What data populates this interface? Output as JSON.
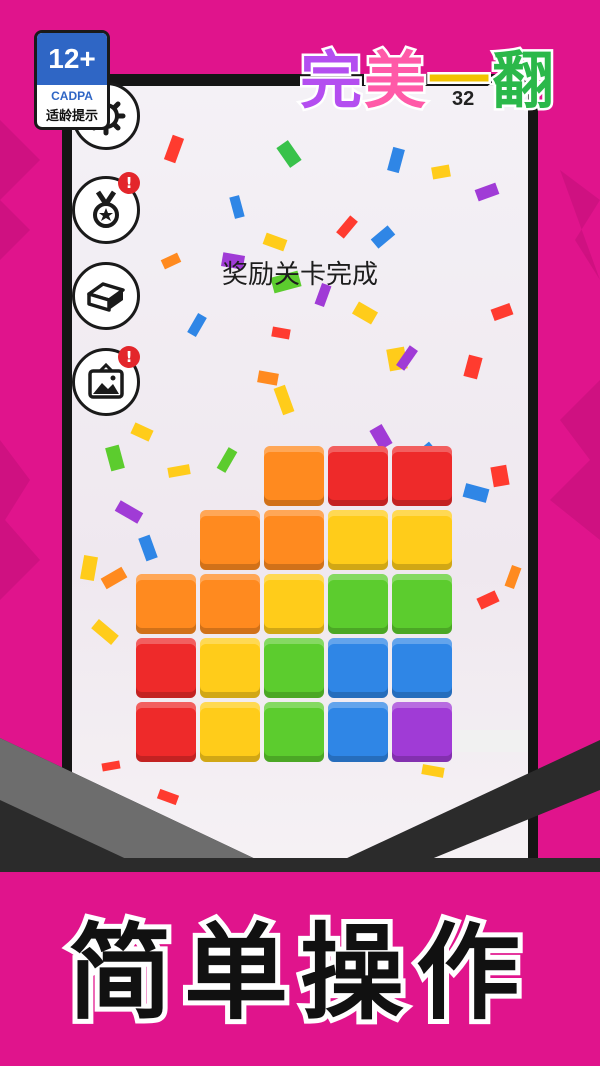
{
  "age_rating": {
    "label": "12+",
    "org": "CADPA",
    "notice": "适龄提示"
  },
  "game_title": {
    "chars": [
      "完",
      "美",
      "一",
      "翻"
    ],
    "colors": [
      "#b44ef0",
      "#ff5aa8",
      "#f2c200",
      "#2bb84a"
    ]
  },
  "level": {
    "number": "32"
  },
  "screen": {
    "message": "奖励关卡完成"
  },
  "side_buttons": [
    {
      "icon": "gear-icon",
      "badge": ""
    },
    {
      "icon": "medal-icon",
      "badge": "!"
    },
    {
      "icon": "eraser-icon",
      "badge": ""
    },
    {
      "icon": "picture-icon",
      "badge": "!"
    }
  ],
  "board": {
    "rows": [
      [
        "",
        "",
        "orange",
        "red",
        "red"
      ],
      [
        "",
        "orange",
        "orange",
        "yellow",
        "yellow"
      ],
      [
        "orange",
        "orange",
        "yellow",
        "green",
        "green"
      ],
      [
        "red",
        "yellow",
        "green",
        "blue",
        "blue"
      ],
      [
        "red",
        "yellow",
        "green",
        "blue",
        "purple"
      ]
    ],
    "palette": {
      "red": "#ee2a2a",
      "orange": "#ff8a1f",
      "yellow": "#ffcc1a",
      "green": "#5ccc2e",
      "blue": "#2f86e6",
      "purple": "#a03bd6"
    }
  },
  "bottom_banner": {
    "text": "简单操作"
  },
  "colors": {
    "background": "#e0148c",
    "stripe_dark": "#2b2b2b",
    "stripe_grey": "#6d6d6d"
  }
}
